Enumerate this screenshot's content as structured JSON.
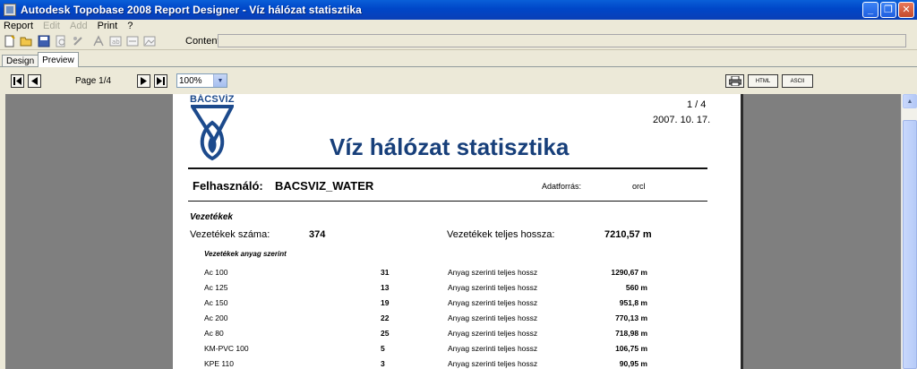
{
  "window": {
    "title": "Autodesk Topobase 2008 Report Designer  - Víz hálózat statisztika",
    "minimize_icon": "minimize-icon",
    "maximize_icon": "maximize-icon",
    "close_icon": "close-icon"
  },
  "menu": {
    "items": [
      {
        "label": "Report",
        "enabled": true
      },
      {
        "label": "Edit",
        "enabled": false
      },
      {
        "label": "Add",
        "enabled": false
      },
      {
        "label": "Print",
        "enabled": true
      },
      {
        "label": "?",
        "enabled": true
      }
    ]
  },
  "toolbar": {
    "content_label": "Content:",
    "content_value": ""
  },
  "tabs": [
    {
      "label": "Design",
      "active": false
    },
    {
      "label": "Preview",
      "active": true
    }
  ],
  "navigation": {
    "page_label": "Page 1/4",
    "zoom": "100%",
    "html_button": "HTML",
    "ascii_button": "ASCII"
  },
  "report": {
    "logo_text": "BÁCSVÍZ",
    "page_counter": "1 / 4",
    "date": "2007. 10. 17.",
    "title": "Víz hálózat statisztika",
    "user_label": "Felhasználó:",
    "user_value": "BACSVIZ_WATER",
    "source_label": "Adatforrás:",
    "source_value": "orcl",
    "section_title": "Vezetékek",
    "count_label": "Vezetékek száma:",
    "count_value": "374",
    "total_length_label": "Vezetékek teljes hossza:",
    "total_length_value": "7210,57 m",
    "subsection_title": "Vezetékek anyag szerint",
    "rows": [
      {
        "material": "Ac 100",
        "count": "31",
        "label": "Anyag szerinti teljes hossz",
        "length": "1290,67 m"
      },
      {
        "material": "Ac 125",
        "count": "13",
        "label": "Anyag szerinti teljes hossz",
        "length": "560 m"
      },
      {
        "material": "Ac 150",
        "count": "19",
        "label": "Anyag szerinti teljes hossz",
        "length": "951,8 m"
      },
      {
        "material": "Ac 200",
        "count": "22",
        "label": "Anyag szerinti teljes hossz",
        "length": "770,13 m"
      },
      {
        "material": "Ac 80",
        "count": "25",
        "label": "Anyag szerinti teljes hossz",
        "length": "718,98 m"
      },
      {
        "material": "KM-PVC 100",
        "count": "5",
        "label": "Anyag szerinti teljes hossz",
        "length": "106,75 m"
      },
      {
        "material": "KPE 110",
        "count": "3",
        "label": "Anyag szerinti teljes hossz",
        "length": "90,95 m"
      }
    ]
  },
  "colors": {
    "title_bar": "#0046c8",
    "report_title": "#173f7a",
    "preview_bg": "#7f7f7f"
  }
}
